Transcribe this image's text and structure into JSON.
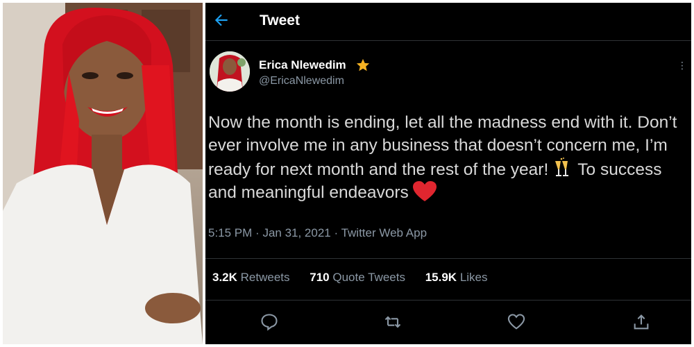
{
  "header": {
    "title": "Tweet"
  },
  "author": {
    "display_name": "Erica Nlewedim",
    "handle": "@EricaNlewedim",
    "badge_icon": "star-icon"
  },
  "tweet": {
    "text_part1": "Now the month is ending, let all the madness end with it. Don’t ever involve me in any business that doesn’t concern me, I’m ready for next month and the rest of the year!",
    "text_part2": "To success and meaningful endeavors",
    "emoji_1": "clinking-glasses-icon",
    "emoji_2": "red-heart-icon"
  },
  "meta": {
    "time": "5:15 PM",
    "date": "Jan 31, 2021",
    "source": "Twitter Web App"
  },
  "stats": {
    "retweets_count": "3.2K",
    "retweets_label": "Retweets",
    "quotes_count": "710",
    "quotes_label": "Quote Tweets",
    "likes_count": "15.9K",
    "likes_label": "Likes"
  },
  "colors": {
    "background": "#000000",
    "accent": "#1da1f2",
    "secondary_text": "#8b98a5",
    "divider": "#2f3336",
    "badge": "#f5b223"
  }
}
